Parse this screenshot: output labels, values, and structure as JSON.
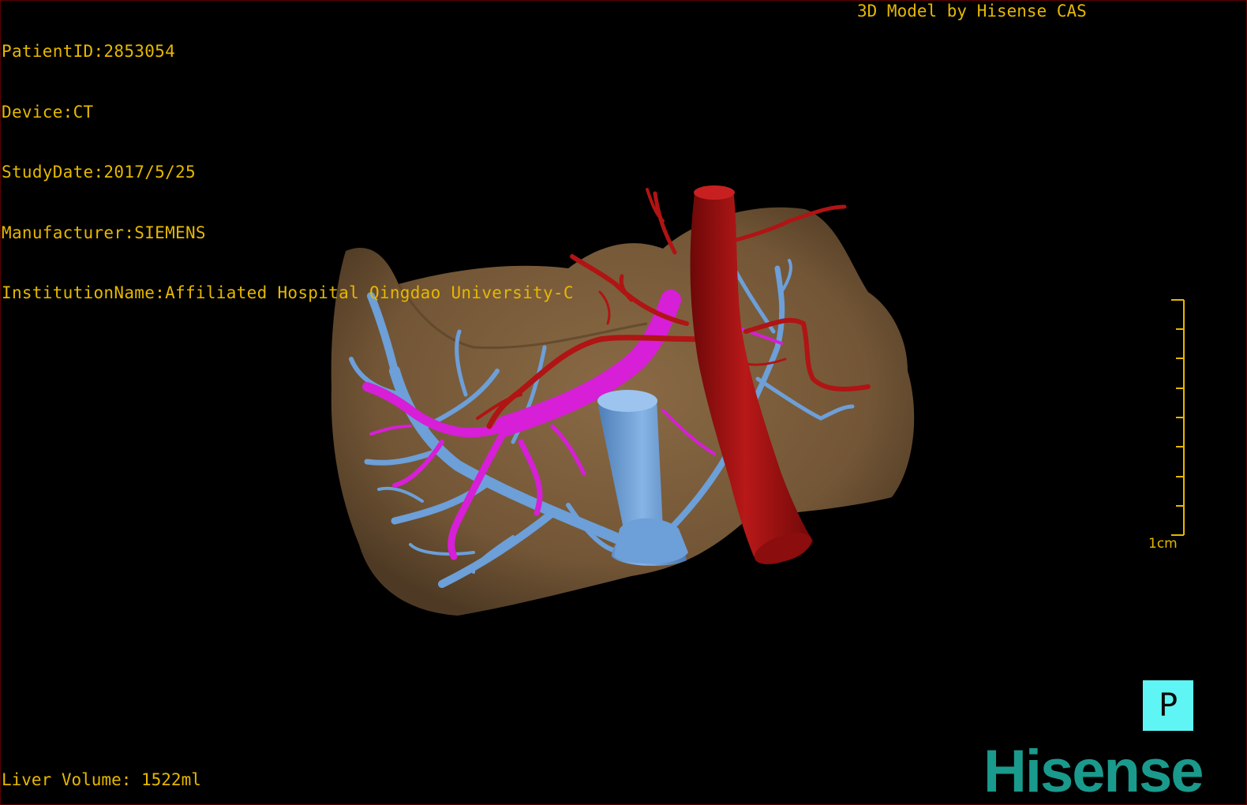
{
  "header": {
    "patient_id": "PatientID:2853054",
    "device": "Device:CT",
    "study_date": "StudyDate:2017/5/25",
    "manufacturer": "Manufacturer:SIEMENS",
    "institution": "InstitutionName:Affiliated Hospital Qingdao University-C",
    "model_credit": "3D Model by Hisense CAS"
  },
  "footer": {
    "liver_volume": "Liver Volume: 1522ml"
  },
  "scale_bar": {
    "label": "1cm"
  },
  "orientation_button": {
    "label": "P"
  },
  "logo": {
    "text": "Hisense"
  },
  "colors": {
    "overlay_text": "#e6b800",
    "liver": "#7a5d3c",
    "hepatic_vein": "#6d9fd8",
    "portal_vein": "#d61fd6",
    "artery_aorta": "#a81010",
    "orientation_cube": "#5ff5f5",
    "logo": "#1a9a8c"
  },
  "icons": {
    "orientation_button": "posterior-view-icon",
    "scale_bar": "ruler-icon"
  }
}
